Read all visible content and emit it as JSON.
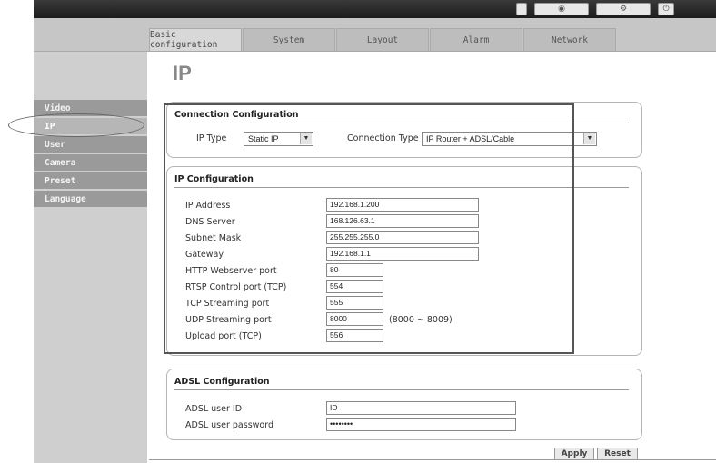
{
  "topbar": {
    "controls": [
      "",
      "◉",
      "⚙",
      "⏻"
    ]
  },
  "tabs": [
    {
      "label": "Basic configuration",
      "active": true
    },
    {
      "label": "System",
      "active": false
    },
    {
      "label": "Layout",
      "active": false
    },
    {
      "label": "Alarm",
      "active": false
    },
    {
      "label": "Network",
      "active": false
    }
  ],
  "sidebar": {
    "items": [
      {
        "label": "Video"
      },
      {
        "label": "IP"
      },
      {
        "label": "User"
      },
      {
        "label": "Camera"
      },
      {
        "label": "Preset"
      },
      {
        "label": "Language"
      }
    ]
  },
  "page": {
    "title": "IP"
  },
  "connection": {
    "title": "Connection Configuration",
    "ip_type_label": "IP Type",
    "ip_type_value": "Static IP",
    "connection_type_label": "Connection Type",
    "connection_type_value": "IP Router + ADSL/Cable"
  },
  "ip_config": {
    "title": "IP Configuration",
    "fields": [
      {
        "label": "IP Address",
        "value": "192.168.1.200"
      },
      {
        "label": "DNS Server",
        "value": "168.126.63.1"
      },
      {
        "label": "Subnet Mask",
        "value": "255.255.255.0"
      },
      {
        "label": "Gateway",
        "value": "192.168.1.1"
      },
      {
        "label": "HTTP Webserver port",
        "value": "80"
      },
      {
        "label": "RTSP Control port (TCP)",
        "value": "554"
      },
      {
        "label": "TCP Streaming port",
        "value": "555"
      },
      {
        "label": "UDP Streaming port",
        "value": "8000"
      },
      {
        "label": "Upload port (TCP)",
        "value": "556"
      }
    ],
    "udp_range_hint": "(8000 ~ 8009)"
  },
  "adsl": {
    "title": "ADSL Configuration",
    "user_id_label": "ADSL user ID",
    "user_id_value": "ID",
    "password_label": "ADSL user password",
    "password_value": "••••••••"
  },
  "buttons": {
    "apply": "Apply",
    "reset": "Reset"
  }
}
